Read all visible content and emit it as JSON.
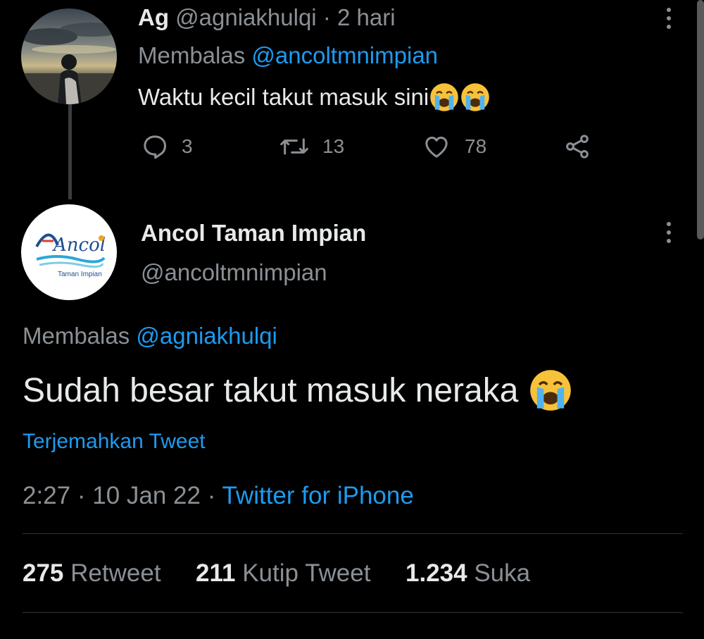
{
  "reply_tweet": {
    "display_name": "Ag",
    "handle": "@agniakhulqi",
    "separator": "·",
    "time_ago": "2 hari",
    "replying_label": "Membalas",
    "replying_to": "@ancoltmnimpian",
    "text": "Waktu kecil takut masuk sini",
    "emoji_count": 2,
    "emoji_name": "loudly-crying-face",
    "actions": {
      "reply_count": "3",
      "retweet_count": "13",
      "like_count": "78"
    }
  },
  "main_tweet": {
    "display_name": "Ancol Taman Impian",
    "handle": "@ancoltmnimpian",
    "avatar_logo_text": "Ancol",
    "avatar_logo_subtext": "Taman Impian",
    "replying_label": "Membalas",
    "replying_to": "@agniakhulqi",
    "text": "Sudah besar takut masuk neraka",
    "translate_label": "Terjemahkan Tweet",
    "time": "2:27",
    "separator": "·",
    "date": "10 Jan 22",
    "source": "Twitter for iPhone",
    "stats": {
      "retweet_count": "275",
      "retweet_label": "Retweet",
      "quote_count": "211",
      "quote_label": "Kutip Tweet",
      "like_count": "1.234",
      "like_label": "Suka"
    }
  },
  "colors": {
    "background": "#000000",
    "text": "#e7e9ea",
    "muted": "#8b9095",
    "link": "#1d9bf0"
  }
}
